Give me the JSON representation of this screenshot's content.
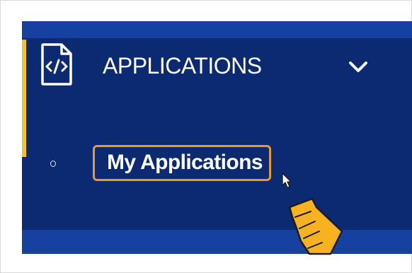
{
  "nav": {
    "section": {
      "label": "APPLICATIONS",
      "icon": "code-file-icon",
      "expand_icon": "chevron-down-icon",
      "expanded": true
    },
    "items": [
      {
        "label": "My Applications",
        "bullet": "circle-bullet-icon",
        "highlighted": true
      }
    ]
  },
  "colors": {
    "sidebar": "#0b2a72",
    "strip": "#1641a0",
    "accent": "#f0c22b",
    "highlight": "#e59a3a",
    "pointer": "#f7b21f"
  },
  "annotation": {
    "pointer_icon": "hand-pointer-icon"
  }
}
